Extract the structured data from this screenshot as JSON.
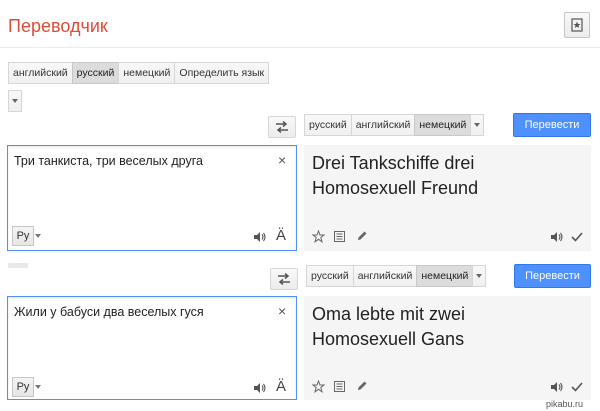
{
  "app": {
    "title": "Переводчик"
  },
  "top_source_langs": [
    "английский",
    "русский",
    "немецкий",
    "Определить язык"
  ],
  "blocks": [
    {
      "target_langs": [
        "русский",
        "английский",
        "немецкий"
      ],
      "translate_label": "Перевести",
      "source_text": "Три танкиста, три веселых друга",
      "result_lines": [
        "Drei Tankschiffe drei",
        "Homosexuell Freund"
      ],
      "input_method_label": "Ру"
    },
    {
      "target_langs": [
        "русский",
        "английский",
        "немецкий"
      ],
      "translate_label": "Перевести",
      "source_text": "Жили у бабуси два веселых гуся",
      "result_lines": [
        "Oma lebte mit zwei",
        "Homosexuell Gans"
      ],
      "input_method_label": "Ру"
    }
  ],
  "icons": {
    "star": "star-icon",
    "swap": "swap-arrows-icon",
    "close": "close-icon",
    "speaker": "speaker-icon",
    "keyboard_char": "Ä",
    "list": "list-icon",
    "pencil": "pencil-icon",
    "check": "check-icon"
  },
  "close_glyph": "×",
  "keyboard_glyph": "Ä",
  "watermark": "pikabu.ru",
  "colors": {
    "title": "#dd4b39",
    "accent": "#4d90fe",
    "result_bg": "#f5f5f5"
  }
}
